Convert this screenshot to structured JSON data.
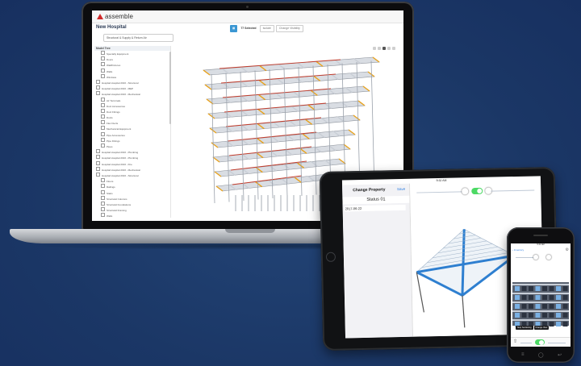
{
  "laptop": {
    "app_name": "assemble",
    "project_title": "New Hospital",
    "model_dropdown": "Structural & Supply & Return Air",
    "toolbar": {
      "selected_count": "77 Selected",
      "isolate_label": "Isolate",
      "change_visibility_label": "Change Visibility"
    },
    "tree_header": "Model Tree",
    "tree_items": [
      "Specialty Equipment",
      "Doors",
      "Wall/Fixtures",
      "Walls",
      "Windows",
      "Hospital Hospital 2016 - Structural",
      "Hospital Hospital 2016 - MEP",
      "Hospital Hospital 2016 - Mechanical",
      "Air Terminals",
      "Duct Accessories",
      "Duct Fittings",
      "Ducts",
      "Flex Ducts",
      "Mechanical Equipment",
      "Pipe Accessories",
      "Pipe Fittings",
      "Pipes",
      "Hospital Hospital 2016 - Plumbing",
      "Hospital Hospital 2016 - Plumbing",
      "Hospital Hospital 2016 - Fire",
      "Hospital Hospital 2016 - Mechanical",
      "Hospital Hospital 2016 - Structural",
      "Floors",
      "Railings",
      "Stairs",
      "Structural Columns",
      "Structural Foundations",
      "Structural Framing",
      "Walls"
    ]
  },
  "tablet": {
    "status_time": "9:32 AM",
    "panel_title": "Change Property",
    "save_label": "Save",
    "status_value": "Status 01",
    "date_value": "2017-06-22"
  },
  "phone": {
    "back_label": "Inventory",
    "status_time": "9:41 AM",
    "buttons": [
      "Stop Sectioning",
      "Change View"
    ]
  },
  "colors": {
    "background": "#1b3766",
    "accent_blue": "#3b97d3",
    "toggle_green": "#4cd964",
    "link_blue": "#2f7ee0"
  }
}
